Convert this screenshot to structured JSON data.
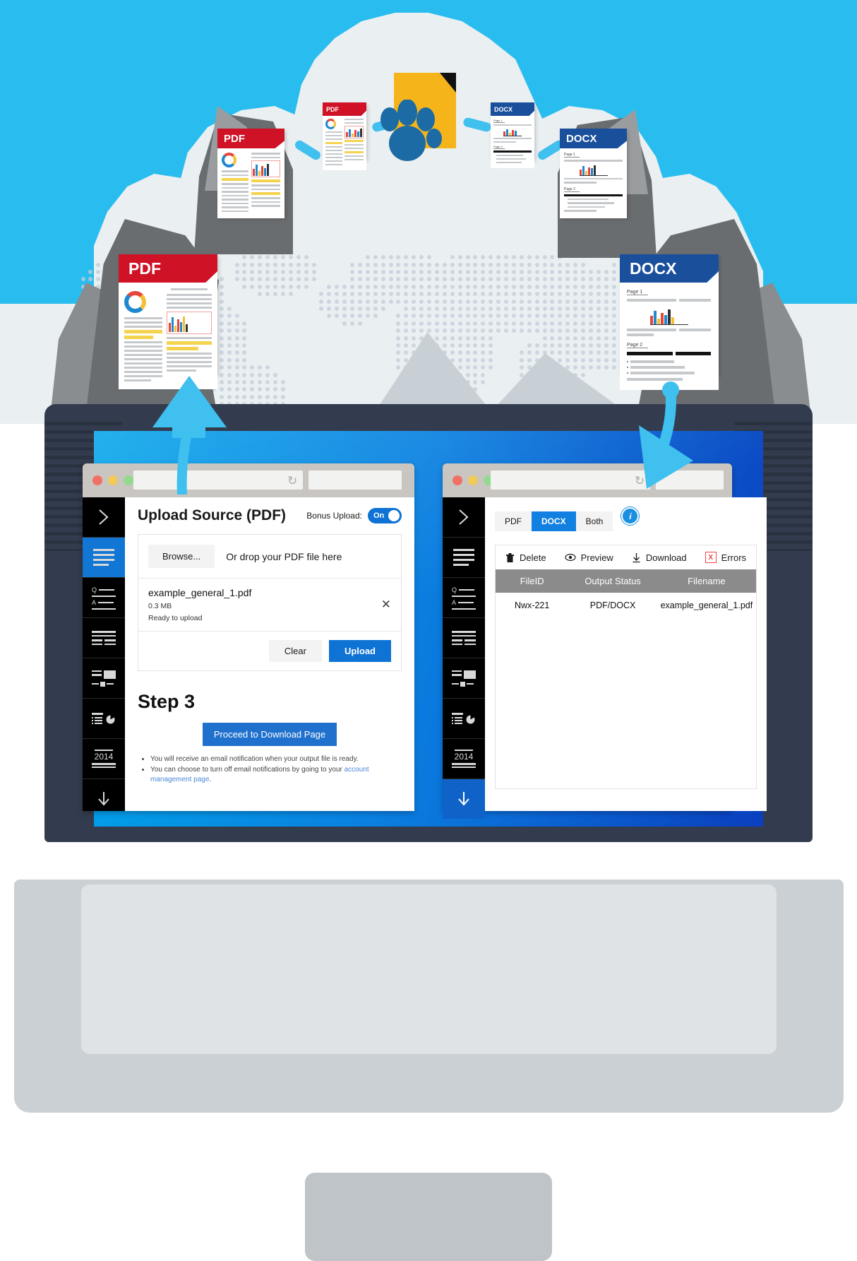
{
  "illustration": {
    "files": [
      {
        "type": "PDF",
        "label": "PDF",
        "size": "large-left"
      },
      {
        "type": "PDF",
        "label": "PDF",
        "size": "small-left"
      },
      {
        "type": "DOCX",
        "label": "DOCX",
        "size": "small-right"
      },
      {
        "type": "DOCX",
        "label": "DOCX",
        "size": "large-right"
      }
    ],
    "logo_icon": "paw-document-icon",
    "arrow_up_icon": "arrow-up-icon",
    "arrow_down_icon": "arrow-down-icon",
    "doc_sections": {
      "page1": "Page 1",
      "page2": "Page 2"
    }
  },
  "colors": {
    "sky": "#29bdef",
    "cloud": "#eaeff2",
    "pdf_red": "#cf1225",
    "docx_blue": "#1a4f9c",
    "accent_blue": "#0f73d6",
    "logo_yellow": "#f5b51a",
    "paw_blue": "#1d6ba4",
    "arrow_cyan": "#3fc0ef"
  },
  "left_window": {
    "browser": {
      "lights": [
        "#f07066",
        "#f2ca58",
        "#93d98e"
      ],
      "reload_icon": "reload-icon",
      "url_value": "",
      "url_placeholder": ""
    },
    "sidebar": [
      {
        "name": "chevron-right-icon",
        "active": false
      },
      {
        "name": "text-lines-icon",
        "active": true
      },
      {
        "name": "qa-lines-icon",
        "active": false
      },
      {
        "name": "columns-text-icon",
        "active": false
      },
      {
        "name": "image-text-icon",
        "active": false
      },
      {
        "name": "chart-list-icon",
        "active": false
      },
      {
        "name": "year-2014-icon",
        "active": false,
        "label": "2014"
      },
      {
        "name": "download-arrow-icon",
        "active": false
      }
    ],
    "title": "Upload Source (PDF)",
    "bonus_label": "Bonus Upload:",
    "toggle_state": "On",
    "browse_label": "Browse...",
    "drop_hint": "Or drop your PDF file here",
    "file": {
      "name": "example_general_1.pdf",
      "size": "0.3 MB",
      "status": "Ready to upload",
      "remove_icon": "close-icon"
    },
    "clear_label": "Clear",
    "upload_label": "Upload",
    "step_title": "Step 3",
    "proceed_label": "Proceed to Download Page",
    "notes": [
      "You will receive an email notification when your output file is ready.",
      "You can choose to turn off email notifications by going to your "
    ],
    "note_link": "account management page",
    "note_tail": "."
  },
  "right_window": {
    "browser": {
      "lights": [
        "#f07066",
        "#f2ca58",
        "#93d98e"
      ],
      "reload_icon": "reload-icon",
      "url_value": "",
      "url_placeholder": ""
    },
    "sidebar": [
      {
        "name": "chevron-right-icon",
        "active": false
      },
      {
        "name": "text-lines-icon",
        "active": false
      },
      {
        "name": "qa-lines-icon",
        "active": false
      },
      {
        "name": "columns-text-icon",
        "active": false
      },
      {
        "name": "image-text-icon",
        "active": false
      },
      {
        "name": "chart-list-icon",
        "active": false
      },
      {
        "name": "year-2014-icon",
        "active": false,
        "label": "2014"
      },
      {
        "name": "download-arrow-icon",
        "active": true
      }
    ],
    "format_tabs": [
      {
        "label": "PDF",
        "selected": false
      },
      {
        "label": "DOCX",
        "selected": true
      },
      {
        "label": "Both",
        "selected": false
      }
    ],
    "info_icon_label": "i",
    "toolbar": [
      {
        "label": "Delete",
        "icon": "trash-icon"
      },
      {
        "label": "Preview",
        "icon": "eye-icon"
      },
      {
        "label": "Download",
        "icon": "download-icon"
      },
      {
        "label": "Errors",
        "icon": "error-x-icon"
      }
    ],
    "table": {
      "columns": [
        "FileID",
        "Output Status",
        "Filename"
      ],
      "rows": [
        [
          "Nwx-221",
          "PDF/DOCX",
          "example_general_1.pdf"
        ]
      ]
    }
  }
}
